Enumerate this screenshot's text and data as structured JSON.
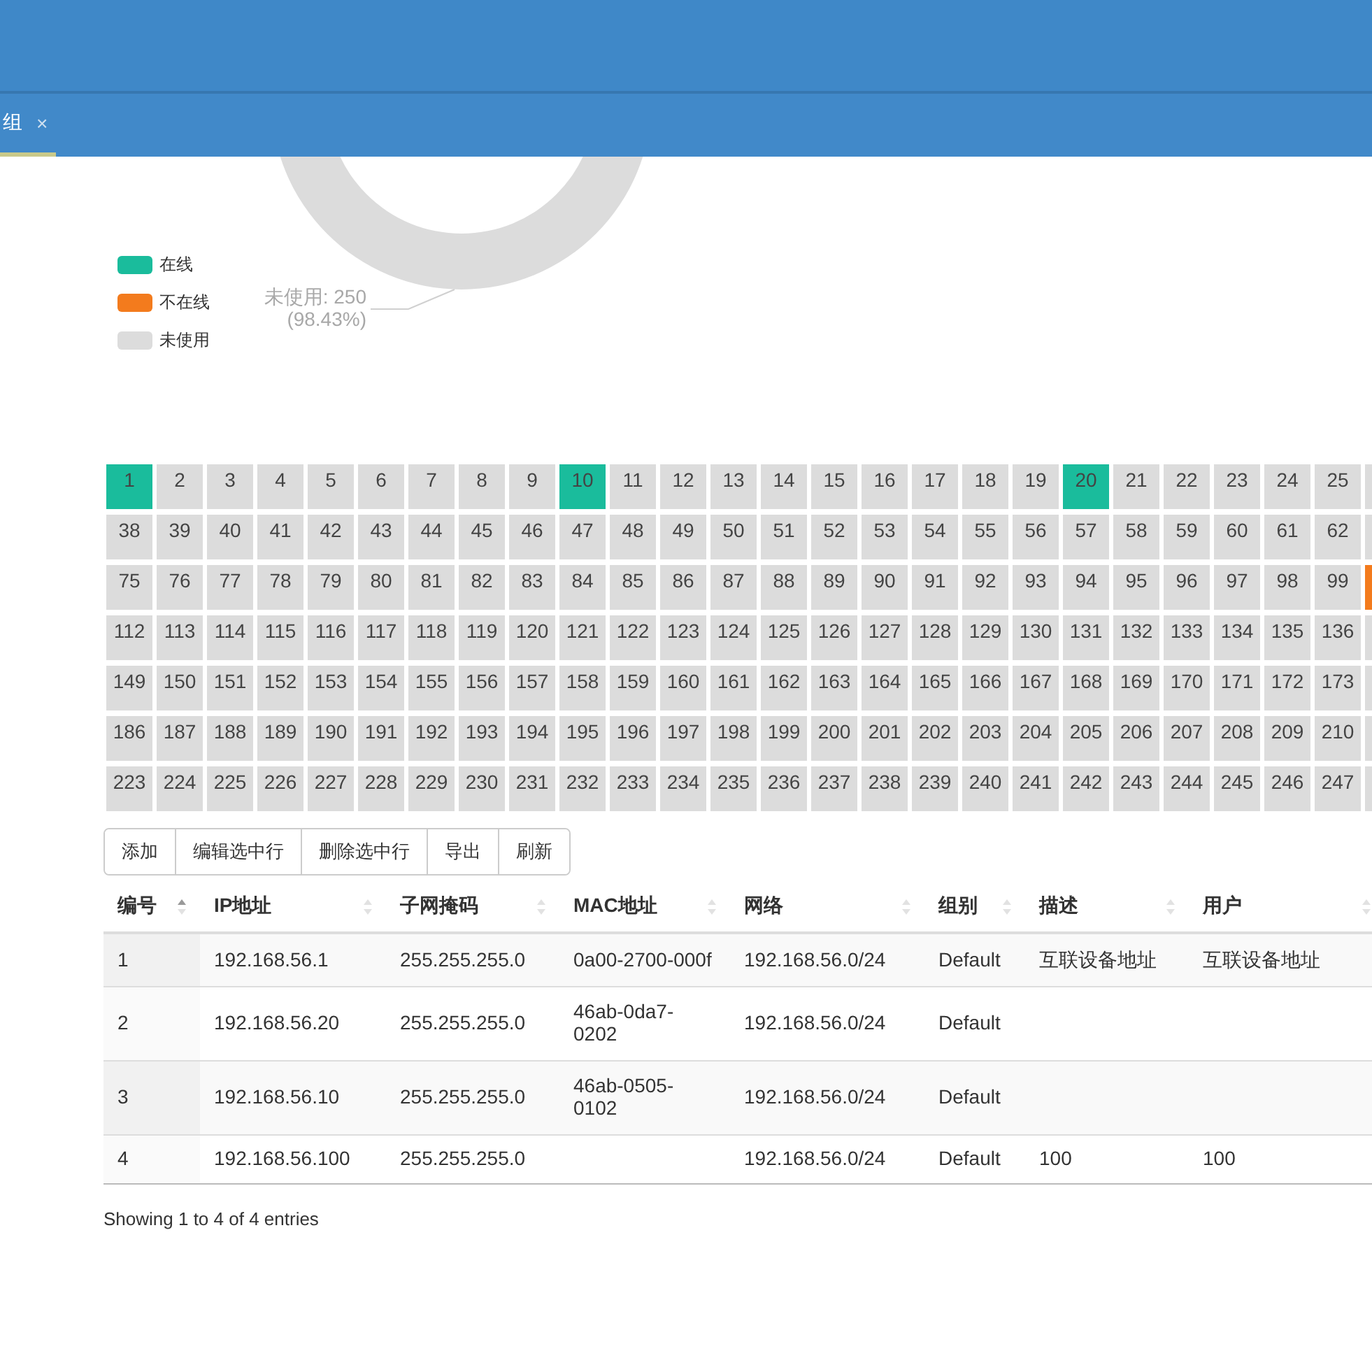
{
  "tabs": [
    {
      "label": "组",
      "selected": true,
      "close": "×"
    }
  ],
  "legend": [
    {
      "label": "在线",
      "color": "#1abc9c"
    },
    {
      "label": "不在线",
      "color": "#f37b1d"
    },
    {
      "label": "未使用",
      "color": "#dcdcdc"
    }
  ],
  "donut": {
    "label": "未使用: 250",
    "percent": "(98.43%)"
  },
  "ip_grid": [
    {
      "cut_cell": {
        "color": "#dcdcdc"
      },
      "cells": [
        {
          "label": "1",
          "color": "#1abc9c"
        },
        {
          "label": "2",
          "color": "#dcdcdc"
        },
        {
          "label": "3",
          "color": "#dcdcdc"
        },
        {
          "label": "4",
          "color": "#dcdcdc"
        },
        {
          "label": "5",
          "color": "#dcdcdc"
        },
        {
          "label": "6",
          "color": "#dcdcdc"
        },
        {
          "label": "7",
          "color": "#dcdcdc"
        },
        {
          "label": "8",
          "color": "#dcdcdc"
        },
        {
          "label": "9",
          "color": "#dcdcdc"
        },
        {
          "label": "10",
          "color": "#1abc9c"
        },
        {
          "label": "11",
          "color": "#dcdcdc"
        },
        {
          "label": "12",
          "color": "#dcdcdc"
        },
        {
          "label": "13",
          "color": "#dcdcdc"
        },
        {
          "label": "14",
          "color": "#dcdcdc"
        },
        {
          "label": "15",
          "color": "#dcdcdc"
        },
        {
          "label": "16",
          "color": "#dcdcdc"
        },
        {
          "label": "17",
          "color": "#dcdcdc"
        },
        {
          "label": "18",
          "color": "#dcdcdc"
        },
        {
          "label": "19",
          "color": "#dcdcdc"
        },
        {
          "label": "20",
          "color": "#1abc9c"
        },
        {
          "label": "21",
          "color": "#dcdcdc"
        },
        {
          "label": "22",
          "color": "#dcdcdc"
        },
        {
          "label": "23",
          "color": "#dcdcdc"
        },
        {
          "label": "24",
          "color": "#dcdcdc"
        },
        {
          "label": "25",
          "color": "#dcdcdc"
        }
      ]
    },
    {
      "cut_cell": {
        "color": "#dcdcdc"
      },
      "cells": [
        {
          "label": "38",
          "color": "#dcdcdc"
        },
        {
          "label": "39",
          "color": "#dcdcdc"
        },
        {
          "label": "40",
          "color": "#dcdcdc"
        },
        {
          "label": "41",
          "color": "#dcdcdc"
        },
        {
          "label": "42",
          "color": "#dcdcdc"
        },
        {
          "label": "43",
          "color": "#dcdcdc"
        },
        {
          "label": "44",
          "color": "#dcdcdc"
        },
        {
          "label": "45",
          "color": "#dcdcdc"
        },
        {
          "label": "46",
          "color": "#dcdcdc"
        },
        {
          "label": "47",
          "color": "#dcdcdc"
        },
        {
          "label": "48",
          "color": "#dcdcdc"
        },
        {
          "label": "49",
          "color": "#dcdcdc"
        },
        {
          "label": "50",
          "color": "#dcdcdc"
        },
        {
          "label": "51",
          "color": "#dcdcdc"
        },
        {
          "label": "52",
          "color": "#dcdcdc"
        },
        {
          "label": "53",
          "color": "#dcdcdc"
        },
        {
          "label": "54",
          "color": "#dcdcdc"
        },
        {
          "label": "55",
          "color": "#dcdcdc"
        },
        {
          "label": "56",
          "color": "#dcdcdc"
        },
        {
          "label": "57",
          "color": "#dcdcdc"
        },
        {
          "label": "58",
          "color": "#dcdcdc"
        },
        {
          "label": "59",
          "color": "#dcdcdc"
        },
        {
          "label": "60",
          "color": "#dcdcdc"
        },
        {
          "label": "61",
          "color": "#dcdcdc"
        },
        {
          "label": "62",
          "color": "#dcdcdc"
        }
      ]
    },
    {
      "cut_cell": {
        "color": "#f37b1d"
      },
      "cells": [
        {
          "label": "75",
          "color": "#dcdcdc"
        },
        {
          "label": "76",
          "color": "#dcdcdc"
        },
        {
          "label": "77",
          "color": "#dcdcdc"
        },
        {
          "label": "78",
          "color": "#dcdcdc"
        },
        {
          "label": "79",
          "color": "#dcdcdc"
        },
        {
          "label": "80",
          "color": "#dcdcdc"
        },
        {
          "label": "81",
          "color": "#dcdcdc"
        },
        {
          "label": "82",
          "color": "#dcdcdc"
        },
        {
          "label": "83",
          "color": "#dcdcdc"
        },
        {
          "label": "84",
          "color": "#dcdcdc"
        },
        {
          "label": "85",
          "color": "#dcdcdc"
        },
        {
          "label": "86",
          "color": "#dcdcdc"
        },
        {
          "label": "87",
          "color": "#dcdcdc"
        },
        {
          "label": "88",
          "color": "#dcdcdc"
        },
        {
          "label": "89",
          "color": "#dcdcdc"
        },
        {
          "label": "90",
          "color": "#dcdcdc"
        },
        {
          "label": "91",
          "color": "#dcdcdc"
        },
        {
          "label": "92",
          "color": "#dcdcdc"
        },
        {
          "label": "93",
          "color": "#dcdcdc"
        },
        {
          "label": "94",
          "color": "#dcdcdc"
        },
        {
          "label": "95",
          "color": "#dcdcdc"
        },
        {
          "label": "96",
          "color": "#dcdcdc"
        },
        {
          "label": "97",
          "color": "#dcdcdc"
        },
        {
          "label": "98",
          "color": "#dcdcdc"
        },
        {
          "label": "99",
          "color": "#dcdcdc"
        }
      ]
    },
    {
      "cut_cell": {
        "color": "#dcdcdc"
      },
      "cells": [
        {
          "label": "112",
          "color": "#dcdcdc"
        },
        {
          "label": "113",
          "color": "#dcdcdc"
        },
        {
          "label": "114",
          "color": "#dcdcdc"
        },
        {
          "label": "115",
          "color": "#dcdcdc"
        },
        {
          "label": "116",
          "color": "#dcdcdc"
        },
        {
          "label": "117",
          "color": "#dcdcdc"
        },
        {
          "label": "118",
          "color": "#dcdcdc"
        },
        {
          "label": "119",
          "color": "#dcdcdc"
        },
        {
          "label": "120",
          "color": "#dcdcdc"
        },
        {
          "label": "121",
          "color": "#dcdcdc"
        },
        {
          "label": "122",
          "color": "#dcdcdc"
        },
        {
          "label": "123",
          "color": "#dcdcdc"
        },
        {
          "label": "124",
          "color": "#dcdcdc"
        },
        {
          "label": "125",
          "color": "#dcdcdc"
        },
        {
          "label": "126",
          "color": "#dcdcdc"
        },
        {
          "label": "127",
          "color": "#dcdcdc"
        },
        {
          "label": "128",
          "color": "#dcdcdc"
        },
        {
          "label": "129",
          "color": "#dcdcdc"
        },
        {
          "label": "130",
          "color": "#dcdcdc"
        },
        {
          "label": "131",
          "color": "#dcdcdc"
        },
        {
          "label": "132",
          "color": "#dcdcdc"
        },
        {
          "label": "133",
          "color": "#dcdcdc"
        },
        {
          "label": "134",
          "color": "#dcdcdc"
        },
        {
          "label": "135",
          "color": "#dcdcdc"
        },
        {
          "label": "136",
          "color": "#dcdcdc"
        }
      ]
    },
    {
      "cut_cell": {
        "color": "#dcdcdc"
      },
      "cells": [
        {
          "label": "149",
          "color": "#dcdcdc"
        },
        {
          "label": "150",
          "color": "#dcdcdc"
        },
        {
          "label": "151",
          "color": "#dcdcdc"
        },
        {
          "label": "152",
          "color": "#dcdcdc"
        },
        {
          "label": "153",
          "color": "#dcdcdc"
        },
        {
          "label": "154",
          "color": "#dcdcdc"
        },
        {
          "label": "155",
          "color": "#dcdcdc"
        },
        {
          "label": "156",
          "color": "#dcdcdc"
        },
        {
          "label": "157",
          "color": "#dcdcdc"
        },
        {
          "label": "158",
          "color": "#dcdcdc"
        },
        {
          "label": "159",
          "color": "#dcdcdc"
        },
        {
          "label": "160",
          "color": "#dcdcdc"
        },
        {
          "label": "161",
          "color": "#dcdcdc"
        },
        {
          "label": "162",
          "color": "#dcdcdc"
        },
        {
          "label": "163",
          "color": "#dcdcdc"
        },
        {
          "label": "164",
          "color": "#dcdcdc"
        },
        {
          "label": "165",
          "color": "#dcdcdc"
        },
        {
          "label": "166",
          "color": "#dcdcdc"
        },
        {
          "label": "167",
          "color": "#dcdcdc"
        },
        {
          "label": "168",
          "color": "#dcdcdc"
        },
        {
          "label": "169",
          "color": "#dcdcdc"
        },
        {
          "label": "170",
          "color": "#dcdcdc"
        },
        {
          "label": "171",
          "color": "#dcdcdc"
        },
        {
          "label": "172",
          "color": "#dcdcdc"
        },
        {
          "label": "173",
          "color": "#dcdcdc"
        }
      ]
    },
    {
      "cut_cell": {
        "color": "#dcdcdc"
      },
      "cells": [
        {
          "label": "186",
          "color": "#dcdcdc"
        },
        {
          "label": "187",
          "color": "#dcdcdc"
        },
        {
          "label": "188",
          "color": "#dcdcdc"
        },
        {
          "label": "189",
          "color": "#dcdcdc"
        },
        {
          "label": "190",
          "color": "#dcdcdc"
        },
        {
          "label": "191",
          "color": "#dcdcdc"
        },
        {
          "label": "192",
          "color": "#dcdcdc"
        },
        {
          "label": "193",
          "color": "#dcdcdc"
        },
        {
          "label": "194",
          "color": "#dcdcdc"
        },
        {
          "label": "195",
          "color": "#dcdcdc"
        },
        {
          "label": "196",
          "color": "#dcdcdc"
        },
        {
          "label": "197",
          "color": "#dcdcdc"
        },
        {
          "label": "198",
          "color": "#dcdcdc"
        },
        {
          "label": "199",
          "color": "#dcdcdc"
        },
        {
          "label": "200",
          "color": "#dcdcdc"
        },
        {
          "label": "201",
          "color": "#dcdcdc"
        },
        {
          "label": "202",
          "color": "#dcdcdc"
        },
        {
          "label": "203",
          "color": "#dcdcdc"
        },
        {
          "label": "204",
          "color": "#dcdcdc"
        },
        {
          "label": "205",
          "color": "#dcdcdc"
        },
        {
          "label": "206",
          "color": "#dcdcdc"
        },
        {
          "label": "207",
          "color": "#dcdcdc"
        },
        {
          "label": "208",
          "color": "#dcdcdc"
        },
        {
          "label": "209",
          "color": "#dcdcdc"
        },
        {
          "label": "210",
          "color": "#dcdcdc"
        }
      ]
    },
    {
      "cut_cell": {
        "color": "#dcdcdc"
      },
      "cells": [
        {
          "label": "223",
          "color": "#dcdcdc"
        },
        {
          "label": "224",
          "color": "#dcdcdc"
        },
        {
          "label": "225",
          "color": "#dcdcdc"
        },
        {
          "label": "226",
          "color": "#dcdcdc"
        },
        {
          "label": "227",
          "color": "#dcdcdc"
        },
        {
          "label": "228",
          "color": "#dcdcdc"
        },
        {
          "label": "229",
          "color": "#dcdcdc"
        },
        {
          "label": "230",
          "color": "#dcdcdc"
        },
        {
          "label": "231",
          "color": "#dcdcdc"
        },
        {
          "label": "232",
          "color": "#dcdcdc"
        },
        {
          "label": "233",
          "color": "#dcdcdc"
        },
        {
          "label": "234",
          "color": "#dcdcdc"
        },
        {
          "label": "235",
          "color": "#dcdcdc"
        },
        {
          "label": "236",
          "color": "#dcdcdc"
        },
        {
          "label": "237",
          "color": "#dcdcdc"
        },
        {
          "label": "238",
          "color": "#dcdcdc"
        },
        {
          "label": "239",
          "color": "#dcdcdc"
        },
        {
          "label": "240",
          "color": "#dcdcdc"
        },
        {
          "label": "241",
          "color": "#dcdcdc"
        },
        {
          "label": "242",
          "color": "#dcdcdc"
        },
        {
          "label": "243",
          "color": "#dcdcdc"
        },
        {
          "label": "244",
          "color": "#dcdcdc"
        },
        {
          "label": "245",
          "color": "#dcdcdc"
        },
        {
          "label": "246",
          "color": "#dcdcdc"
        },
        {
          "label": "247",
          "color": "#dcdcdc"
        }
      ]
    }
  ],
  "toolbar": [
    "添加",
    "编辑选中行",
    "删除选中行",
    "导出",
    "刷新"
  ],
  "table": {
    "columns": [
      {
        "label": "编号",
        "sorted": true
      },
      {
        "label": "IP地址",
        "sorted": false
      },
      {
        "label": "子网掩码",
        "sorted": false
      },
      {
        "label": "MAC地址",
        "sorted": false
      },
      {
        "label": "网络",
        "sorted": false
      },
      {
        "label": "组别",
        "sorted": false
      },
      {
        "label": "描述",
        "sorted": false
      },
      {
        "label": "用户",
        "sorted": false
      }
    ],
    "rows": [
      [
        "1",
        "192.168.56.1",
        "255.255.255.0",
        "0a00-2700-000f",
        "192.168.56.0/24",
        "Default",
        "互联设备地址",
        "互联设备地址"
      ],
      [
        "2",
        "192.168.56.20",
        "255.255.255.0",
        "46ab-0da7-0202",
        "192.168.56.0/24",
        "Default",
        "",
        ""
      ],
      [
        "3",
        "192.168.56.10",
        "255.255.255.0",
        "46ab-0505-0102",
        "192.168.56.0/24",
        "Default",
        "",
        ""
      ],
      [
        "4",
        "192.168.56.100",
        "255.255.255.0",
        "",
        "192.168.56.0/24",
        "Default",
        "100",
        "100"
      ]
    ]
  },
  "footer": "Showing 1 to 4 of 4 entries"
}
